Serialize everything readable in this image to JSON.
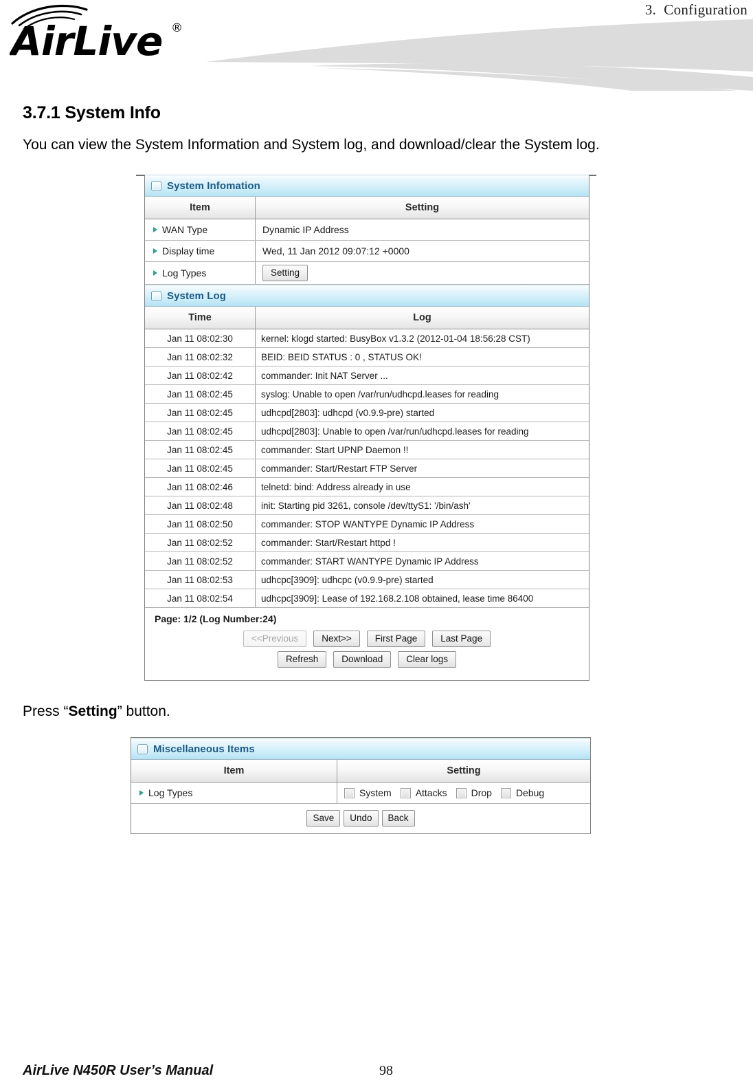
{
  "header": {
    "chapter": "3.  Configuration",
    "logo_text": "AirLive",
    "logo_mark": "®"
  },
  "section": {
    "number_title": "3.7.1 System Info",
    "intro": "You can view the System Information and System log, and download/clear the System log.",
    "press_prefix": "Press “",
    "press_bold": "Setting",
    "press_suffix": "” button."
  },
  "system_information": {
    "panel_title": "System Infomation",
    "columns": [
      "Item",
      "Setting"
    ],
    "rows": [
      {
        "item": "WAN Type",
        "setting": "Dynamic IP Address",
        "type": "text"
      },
      {
        "item": "Display time",
        "setting": "Wed, 11 Jan 2012 09:07:12 +0000",
        "type": "text"
      },
      {
        "item": "Log Types",
        "setting": "Setting",
        "type": "button"
      }
    ]
  },
  "system_log": {
    "panel_title": "System Log",
    "columns": [
      "Time",
      "Log"
    ],
    "entries": [
      {
        "time": "Jan 11 08:02:30",
        "log": "kernel: klogd started: BusyBox v1.3.2 (2012-01-04 18:56:28 CST)"
      },
      {
        "time": "Jan 11 08:02:32",
        "log": "BEID: BEID STATUS : 0 , STATUS OK!"
      },
      {
        "time": "Jan 11 08:02:42",
        "log": "commander: Init NAT Server ..."
      },
      {
        "time": "Jan 11 08:02:45",
        "log": "syslog: Unable to open /var/run/udhcpd.leases for reading"
      },
      {
        "time": "Jan 11 08:02:45",
        "log": "udhcpd[2803]: udhcpd (v0.9.9-pre) started"
      },
      {
        "time": "Jan 11 08:02:45",
        "log": "udhcpd[2803]: Unable to open /var/run/udhcpd.leases for reading"
      },
      {
        "time": "Jan 11 08:02:45",
        "log": "commander: Start UPNP Daemon !!"
      },
      {
        "time": "Jan 11 08:02:45",
        "log": "commander: Start/Restart FTP Server"
      },
      {
        "time": "Jan 11 08:02:46",
        "log": "telnetd: bind: Address already in use"
      },
      {
        "time": "Jan 11 08:02:48",
        "log": "init: Starting pid 3261, console /dev/ttyS1: '/bin/ash'"
      },
      {
        "time": "Jan 11 08:02:50",
        "log": "commander: STOP WANTYPE Dynamic IP Address"
      },
      {
        "time": "Jan 11 08:02:52",
        "log": "commander: Start/Restart httpd !"
      },
      {
        "time": "Jan 11 08:02:52",
        "log": "commander: START WANTYPE Dynamic IP Address"
      },
      {
        "time": "Jan 11 08:02:53",
        "log": "udhcpc[3909]: udhcpc (v0.9.9-pre) started"
      },
      {
        "time": "Jan 11 08:02:54",
        "log": "udhcpc[3909]: Lease of 192.168.2.108 obtained, lease time 86400"
      }
    ],
    "page_status": "Page: 1/2 (Log Number:24)",
    "nav_buttons": [
      {
        "label": "<<Previous",
        "disabled": true
      },
      {
        "label": "Next>>",
        "disabled": false
      },
      {
        "label": "First Page",
        "disabled": false
      },
      {
        "label": "Last Page",
        "disabled": false
      }
    ],
    "action_buttons": [
      {
        "label": "Refresh"
      },
      {
        "label": "Download"
      },
      {
        "label": "Clear logs"
      }
    ]
  },
  "miscellaneous": {
    "panel_title": "Miscellaneous Items",
    "columns": [
      "Item",
      "Setting"
    ],
    "row_label": "Log Types",
    "checkboxes": [
      {
        "label": "System",
        "checked": false
      },
      {
        "label": "Attacks",
        "checked": false
      },
      {
        "label": "Drop",
        "checked": false
      },
      {
        "label": "Debug",
        "checked": false
      }
    ],
    "buttons": [
      {
        "label": "Save"
      },
      {
        "label": "Undo"
      },
      {
        "label": "Back"
      }
    ]
  },
  "footer": {
    "manual": "AirLive N450R User’s Manual",
    "page_number": "98"
  },
  "colors": {
    "section_bar_blue": "#c9ecf8",
    "section_title_text": "#1c5a86",
    "bullet_green": "#2f9e8f",
    "swoosh_gray": "#dcdcdc",
    "border_gray": "#808080"
  }
}
